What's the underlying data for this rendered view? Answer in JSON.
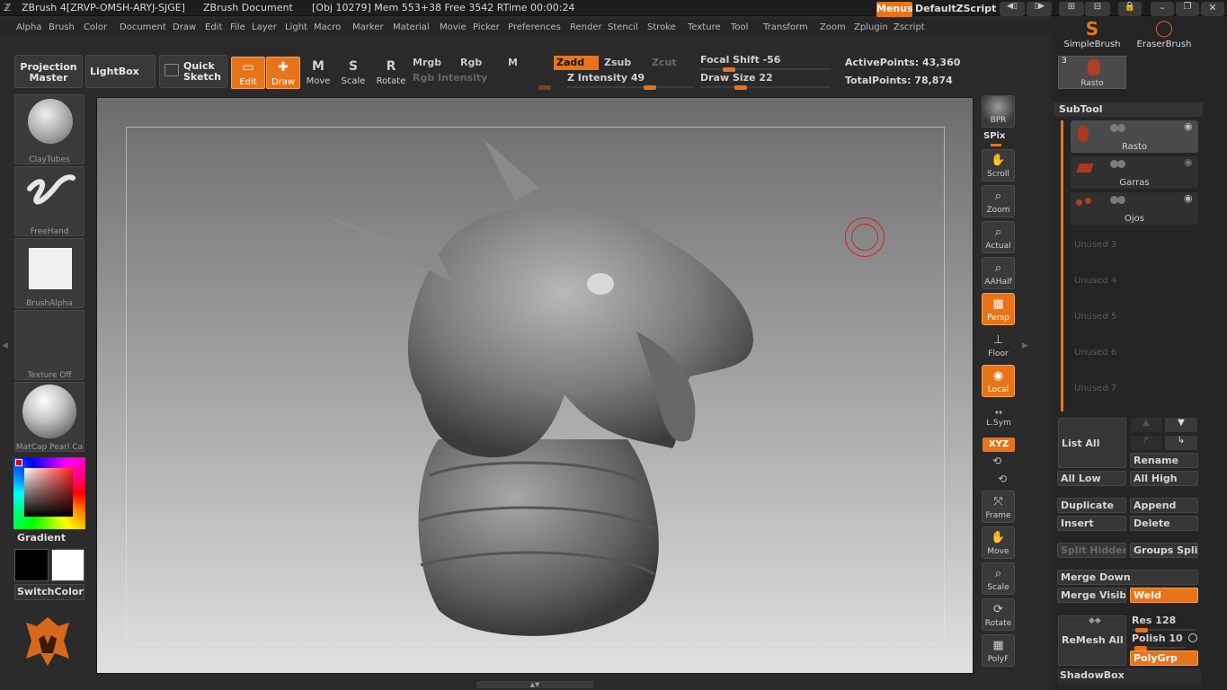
{
  "titlebar": {
    "app": "ZBrush 4[ZRVP-OMSH-ARYJ-SJGE]",
    "doc": "ZBrush Document",
    "stats": "[Obj 10279] Mem 553+38 Free 3542 RTime 00:00:24",
    "menus_label": "Menus",
    "script_label": "DefaultZScript"
  },
  "menubar": [
    "Alpha",
    "Brush",
    "Color",
    "Document",
    "Draw",
    "Edit",
    "File",
    "Layer",
    "Light",
    "Macro",
    "Marker",
    "Material",
    "Movie",
    "Picker",
    "Preferences",
    "Render",
    "Stencil",
    "Stroke",
    "Texture",
    "Tool",
    "Transform",
    "Zoom",
    "Zplugin",
    "Zscript"
  ],
  "toolbar": {
    "projection_master": "Projection Master",
    "lightbox": "LightBox",
    "quick_sketch": "Quick Sketch",
    "modes": [
      {
        "label": "Edit",
        "icon": "▭",
        "on": true
      },
      {
        "label": "Draw",
        "icon": "✚",
        "on": true
      },
      {
        "label": "Move",
        "icon": "M",
        "on": false
      },
      {
        "label": "Scale",
        "icon": "S",
        "on": false
      },
      {
        "label": "Rotate",
        "icon": "R",
        "on": false
      }
    ],
    "mrgb": "Mrgb",
    "rgb": "Rgb",
    "m": "M",
    "zadd": "Zadd",
    "zsub": "Zsub",
    "zcut": "Zcut",
    "rgb_intensity": "Rgb Intensity",
    "z_intensity": "Z Intensity 49",
    "focal_shift": "Focal Shift -56",
    "draw_size": "Draw Size 22",
    "active_points": "ActivePoints: 43,360",
    "total_points": "TotalPoints: 78,874"
  },
  "leftpanel": {
    "brush": "ClayTubes",
    "stroke": "FreeHand",
    "alpha": "BrushAlpha",
    "texture": "Texture Off",
    "material": "MatCap Pearl Ca",
    "gradient": "Gradient",
    "switchcolor": "SwitchColor"
  },
  "rightstrip": [
    {
      "label": "BPR",
      "icon": "●",
      "on": false
    },
    {
      "label": "Scroll",
      "icon": "✋",
      "on": false
    },
    {
      "label": "Zoom",
      "icon": "⌕",
      "on": false
    },
    {
      "label": "Actual",
      "icon": "⌕",
      "on": false
    },
    {
      "label": "AAHalf",
      "icon": "⌕",
      "on": false
    },
    {
      "label": "Persp",
      "icon": "▦",
      "on": true
    },
    {
      "label": "Floor",
      "icon": "⊥",
      "on": false
    },
    {
      "label": "Local",
      "icon": "◉",
      "on": true
    },
    {
      "label": "Frame",
      "icon": "⤧",
      "on": false
    },
    {
      "label": "Move",
      "icon": "✋",
      "on": false
    },
    {
      "label": "Scale",
      "icon": "⌕",
      "on": false
    },
    {
      "label": "Rotate",
      "icon": "⟳",
      "on": false
    },
    {
      "label": "PolyF",
      "icon": "▦",
      "on": false
    }
  ],
  "rightstrip_extra": {
    "spix": "SPix",
    "lsym": "L.Sym",
    "xyz": "XYZ"
  },
  "rightpanel": {
    "brushes": [
      "SimpleBrush",
      "EraserBrush"
    ],
    "tool_count": "3",
    "tool_name": "Rasto",
    "subtool_title": "SubTool",
    "subtools": [
      "Rasto",
      "Garras",
      "Ojos"
    ],
    "unused": [
      "Unused 3",
      "Unused 4",
      "Unused 5",
      "Unused 6",
      "Unused 7"
    ],
    "list_all": "List All",
    "rename": "Rename",
    "all_low": "All Low",
    "all_high": "All High",
    "duplicate": "Duplicate",
    "append": "Append",
    "insert": "Insert",
    "delete": "Delete",
    "split_hidden": "Split Hidden",
    "groups_split": "Groups Split",
    "merge_down": "Merge Down",
    "merge_visible": "Merge Visible",
    "weld": "Weld",
    "remesh_all": "ReMesh All",
    "res": "Res 128",
    "polish": "Polish 10",
    "polygrp": "PolyGrp",
    "shadowbox": "ShadowBox"
  },
  "colors": {
    "accent": "#e8741a",
    "panel": "#2b2b2b",
    "cursor": "#d42020"
  }
}
